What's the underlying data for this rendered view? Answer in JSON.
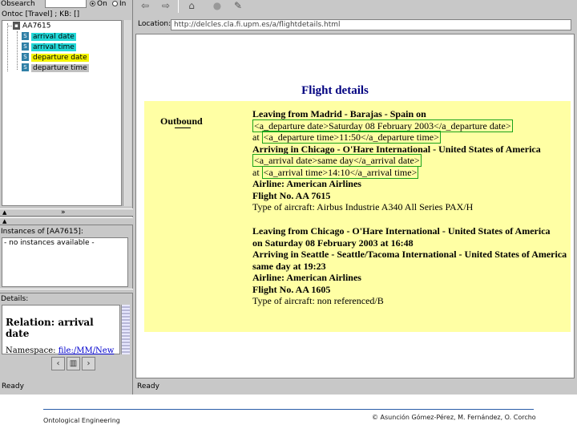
{
  "left": {
    "search_label": "Obsearch",
    "radio_on": "On",
    "radio_in": "In",
    "onto_label": "Ontoc [Travel] ; KB: []",
    "tree": {
      "root": "AA7615",
      "items": [
        {
          "label": "arrival date",
          "bg": "#22d8d8"
        },
        {
          "label": "arrival time",
          "bg": "#22d8d8"
        },
        {
          "label": "departure date",
          "bg": "#f5f500"
        },
        {
          "label": "departure time",
          "bg": "#c0c0c0"
        }
      ]
    },
    "instances_label": "Instances of [AA7615]:",
    "instances_text": "- no instances available -",
    "details_label": "Details:",
    "details_title": "Relation: arrival date",
    "details_ns_label": "Namespace:",
    "details_ns_link": "file:/MM/New",
    "status": "Ready"
  },
  "browser": {
    "location_label": "Location:",
    "url": "http://delcles.cla.fi.upm.es/a/flightdetails.html",
    "status": "Ready",
    "page_title": "Flight details",
    "outbound_label": "Outbound",
    "lines": [
      {
        "pre": "",
        "bold": "Leaving from Madrid - Barajas - Spain on",
        "ann": "",
        "post": ""
      },
      {
        "pre": "",
        "bold": "",
        "ann": "<a_departure date>Saturday 08 February 2003</a_departure date>",
        "post": ""
      },
      {
        "pre": "at ",
        "bold": "",
        "ann": "<a_departure time>11:50</a_departure time>",
        "post": ""
      },
      {
        "pre": "",
        "bold": "Arriving in Chicago - O'Hare International - United States of America",
        "ann": "",
        "post": ""
      },
      {
        "pre": "",
        "bold": "",
        "ann": "<a_arrival date>same day</a_arrival date>",
        "post": ""
      },
      {
        "pre": "at ",
        "bold": "",
        "ann": "<a_arrival time>14:10</a_arrival time>",
        "post": ""
      },
      {
        "pre": "",
        "bold": "Airline: American Airlines",
        "ann": "",
        "post": ""
      },
      {
        "pre": "",
        "bold": "Flight No. AA 7615",
        "ann": "",
        "post": ""
      },
      {
        "pre": "",
        "bold": "",
        "ann": "",
        "post": "Type of aircraft: Airbus Industrie A340 All Series PAX/H"
      },
      {
        "pre": "",
        "bold": "",
        "ann": "",
        "post": ""
      },
      {
        "pre": "",
        "bold": "Leaving from Chicago - O'Hare International - United States of America",
        "ann": "",
        "post": ""
      },
      {
        "pre": "",
        "bold": "on Saturday 08 February 2003 at 16:48",
        "ann": "",
        "post": ""
      },
      {
        "pre": "",
        "bold": "Arriving in Seattle - Seattle/Tacoma International - United States of America",
        "ann": "",
        "post": ""
      },
      {
        "pre": "",
        "bold": "same day at 19:23",
        "ann": "",
        "post": ""
      },
      {
        "pre": "",
        "bold": "Airline: American Airlines",
        "ann": "",
        "post": ""
      },
      {
        "pre": "",
        "bold": "Flight No. AA 1605",
        "ann": "",
        "post": ""
      },
      {
        "pre": "",
        "bold": "",
        "ann": "",
        "post": "Type of aircraft: non referenced/B"
      }
    ]
  },
  "footer": {
    "left": "Ontological Engineering",
    "right": "© Asunción Gómez-Pérez, M. Fernández, O. Corcho"
  }
}
